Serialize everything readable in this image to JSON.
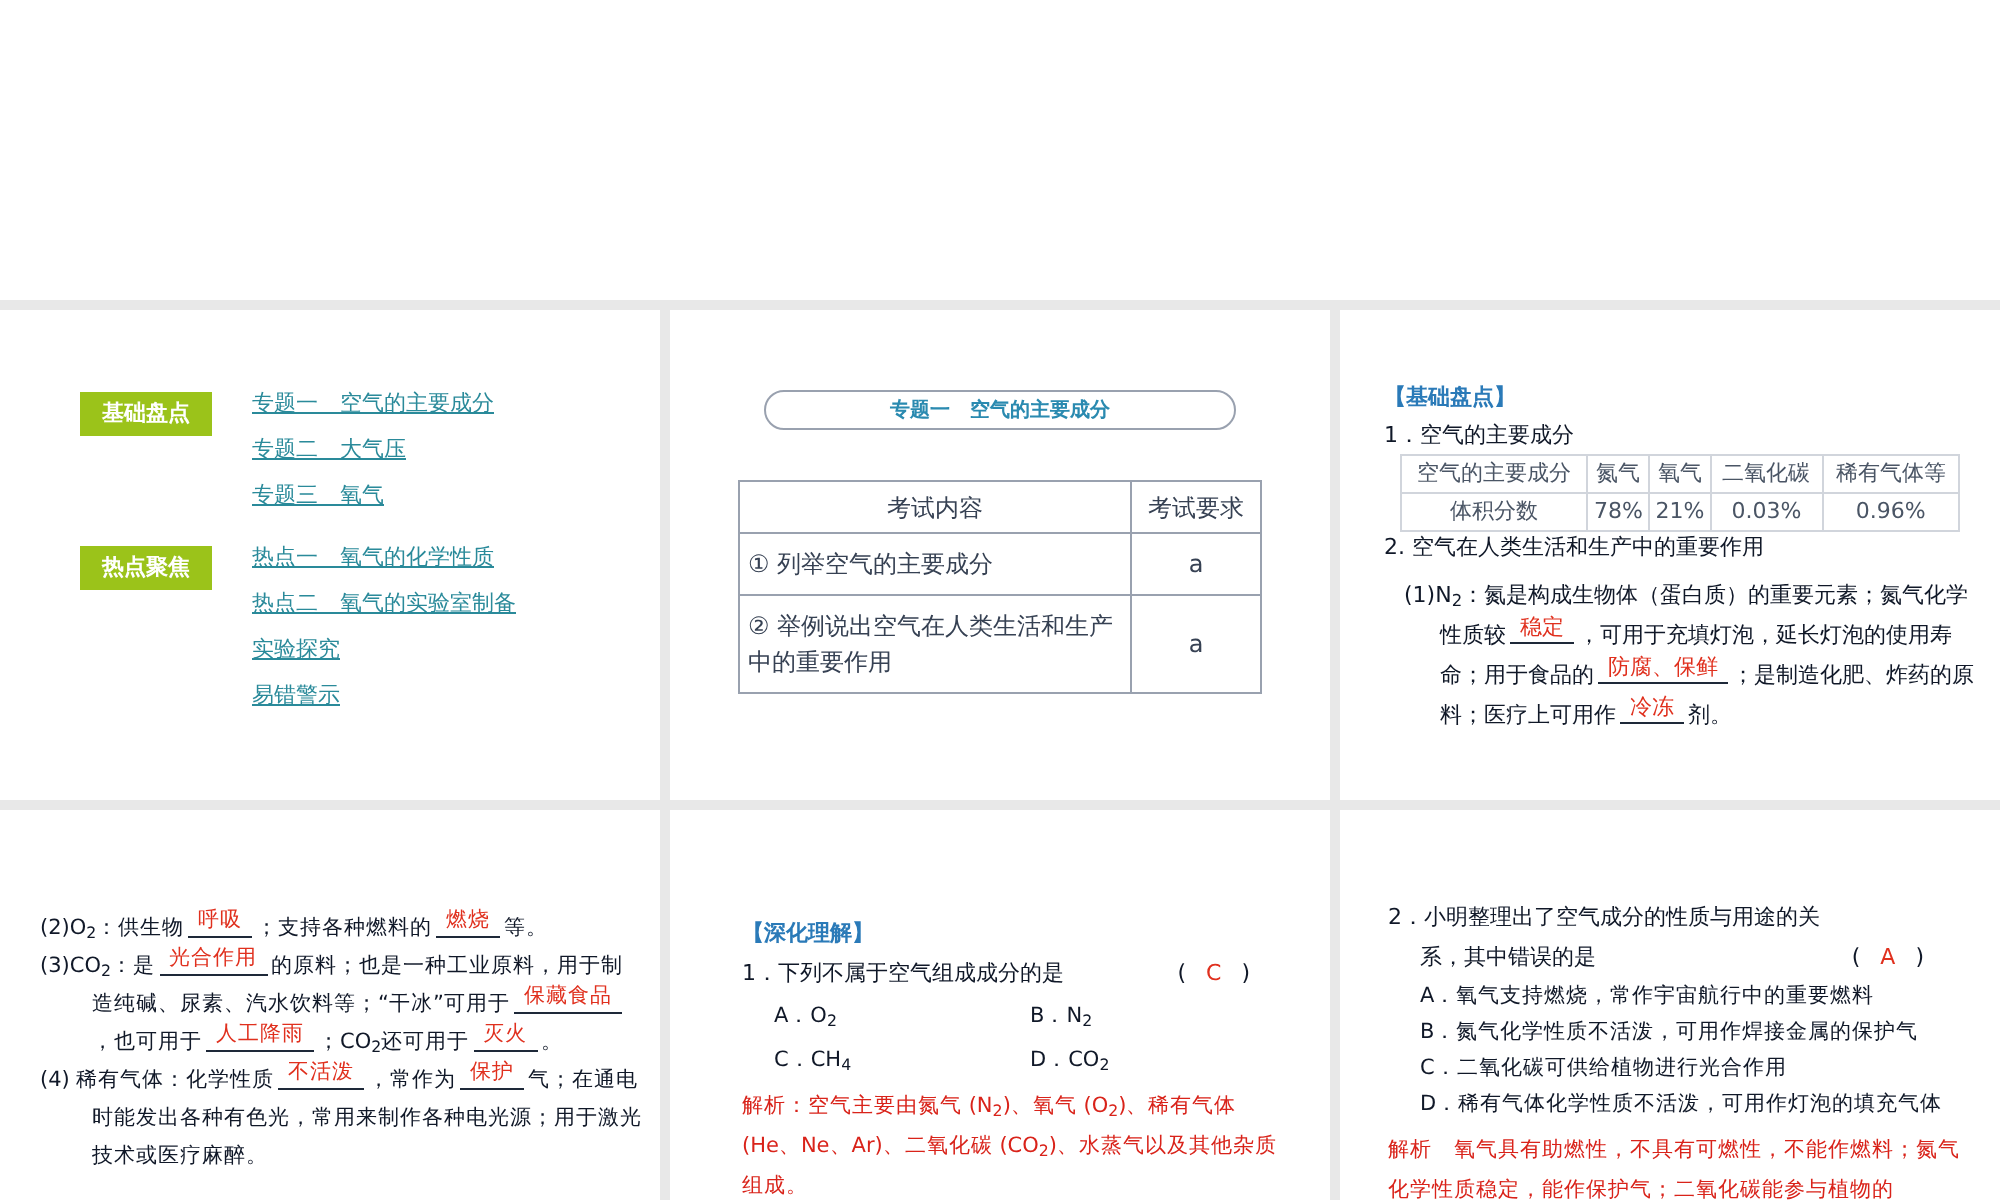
{
  "slides": [
    {
      "kind": "toc",
      "groups": [
        {
          "tag": "基础盘点",
          "links": [
            "专题一　空气的主要成分",
            "专题二　大气压",
            "专题三　氧气"
          ]
        },
        {
          "tag": "热点聚焦",
          "links": [
            "热点一　氧气的化学性质",
            "热点二　氧气的实验室制备",
            "实验探究",
            "易错警示"
          ]
        }
      ]
    },
    {
      "kind": "table",
      "banner": "专题一　空气的主要成分",
      "columns": [
        "考试内容",
        "考试要求"
      ],
      "rows": [
        [
          "① 列举空气的主要成分",
          "a"
        ],
        [
          "② 举例说出空气在人类生活和生产中的重要作用",
          "a"
        ]
      ]
    },
    {
      "kind": "notes",
      "heading": "【基础盘点】",
      "subheading": "1．空气的主要成分",
      "table": {
        "columns": [
          "空气的主要成分",
          "氮气",
          "氧气",
          "二氧化碳",
          "稀有气体等"
        ],
        "rows": [
          [
            "体积分数",
            "78%",
            "21%",
            "0.03%",
            "0.96%"
          ]
        ]
      },
      "section": "2. 空气在人类生活和生产中的重要作用",
      "paragraphs": [
        [
          {
            "kind": "text",
            "text": "(1)N$_{2}$：氮是构成生物体（蛋白质）的重要元素；氮气化学性质较"
          },
          {
            "kind": "blank",
            "answer": "稳定"
          },
          {
            "kind": "text",
            "text": "，可用于充填灯泡，延长灯泡的使用寿命；用于食品的"
          },
          {
            "kind": "blank",
            "answer": "防腐、保鲜"
          },
          {
            "kind": "text",
            "text": "；是制造化肥、炸药的原料；医疗上可用作"
          },
          {
            "kind": "blank",
            "answer": "冷冻"
          },
          {
            "kind": "text",
            "text": "剂。"
          }
        ]
      ]
    },
    {
      "kind": "notes",
      "paragraphs": [
        [
          {
            "kind": "text",
            "text": "(2)O$_{2}$：供生物"
          },
          {
            "kind": "blank",
            "answer": "呼吸"
          },
          {
            "kind": "text",
            "text": "；支持各种燃料的"
          },
          {
            "kind": "blank",
            "answer": "燃烧"
          },
          {
            "kind": "text",
            "text": "等。"
          }
        ],
        [
          {
            "kind": "text",
            "text": "(3)CO$_{2}$：是"
          },
          {
            "kind": "blank",
            "answer": "光合作用"
          },
          {
            "kind": "text",
            "text": "的原料；也是一种工业原料，用于制造纯碱、尿素、汽水饮料等；“干冰”可用于"
          },
          {
            "kind": "blank",
            "answer": "保藏食品"
          },
          {
            "kind": "text",
            "text": "，也可用于"
          },
          {
            "kind": "blank",
            "answer": "人工降雨"
          },
          {
            "kind": "text",
            "text": "；CO$_{2}$还可用于"
          },
          {
            "kind": "blank",
            "answer": "灭火"
          },
          {
            "kind": "text",
            "text": "。"
          }
        ],
        [
          {
            "kind": "text",
            "text": "(4) 稀有气体：化学性质"
          },
          {
            "kind": "blank",
            "answer": "不活泼"
          },
          {
            "kind": "text",
            "text": "，常作为"
          },
          {
            "kind": "blank",
            "answer": "保护"
          },
          {
            "kind": "text",
            "text": "气；在通电时能发出各种有色光，常用来制作各种电光源；用于激光技术或医疗麻醉。"
          }
        ]
      ]
    },
    {
      "kind": "quiz_grid",
      "heading": "【深化理解】",
      "question": "1．下列不属于空气组成成分的是",
      "bracket": {
        "open": "(",
        "answer": "C",
        "close": ")"
      },
      "options": [
        "A．O$_{2}$",
        "B．N$_{2}$",
        "C．CH$_{4}$",
        "D．CO$_{2}$"
      ],
      "analysis": "解析：空气主要由氮气 (N$_{2}$)、氧气 (O$_{2}$)、稀有气体 (He、Ne、Ar)、二氧化碳 (CO$_{2}$)、水蒸气以及其他杂质组成。"
    },
    {
      "kind": "quiz_list",
      "question": "2．小明整理出了空气成分的性质与用途的关系，其中错误的是",
      "bracket": {
        "open": "(",
        "answer": "A",
        "close": ")"
      },
      "options": [
        "A．氧气支持燃烧，常作宇宙航行中的重要燃料",
        "B．氮气化学性质不活泼，可用作焊接金属的保护气",
        "C．二氧化碳可供给植物进行光合作用",
        "D．稀有气体化学性质不活泼，可用作灯泡的填充气体"
      ],
      "analysis": "解析　氧气具有助燃性，不具有可燃性，不能作燃料；氮气化学性质稳定，能作保护气；二氧化碳能参与植物的"
    }
  ]
}
